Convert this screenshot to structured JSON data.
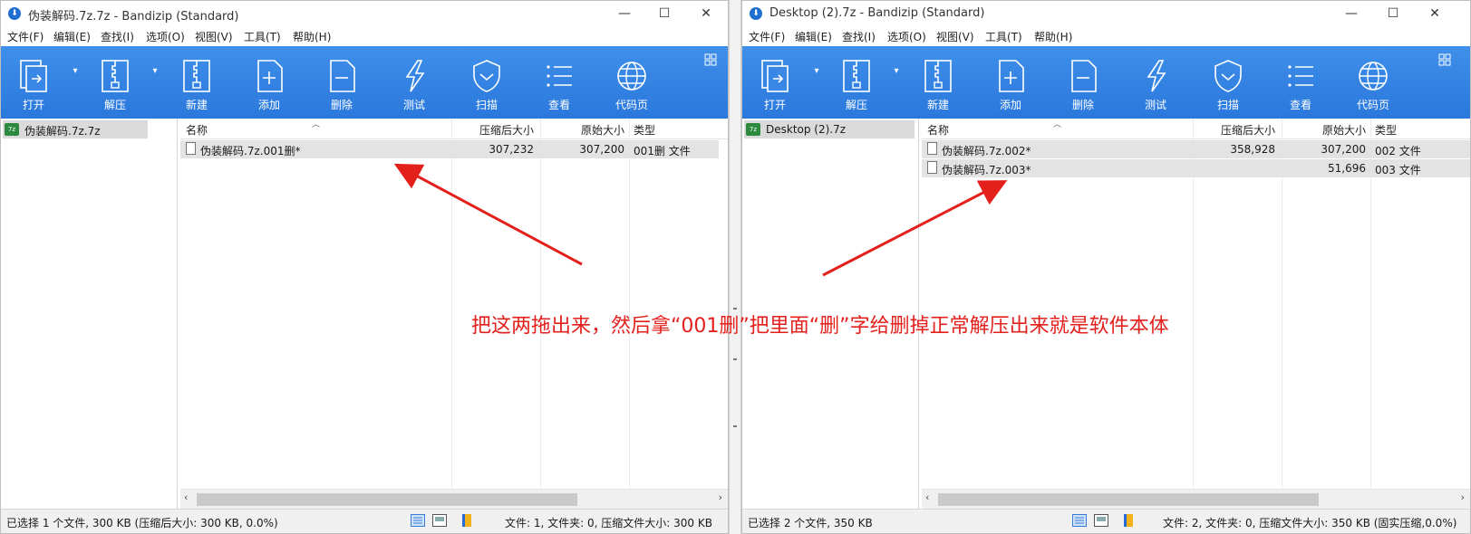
{
  "left": {
    "title": "伪装解码.7z.7z - Bandizip (Standard)",
    "menu": [
      "文件(F)",
      "编辑(E)",
      "查找(I)",
      "选项(O)",
      "视图(V)",
      "工具(T)",
      "帮助(H)"
    ],
    "toolbar": [
      "打开",
      "解压",
      "新建",
      "添加",
      "删除",
      "测试",
      "扫描",
      "查看",
      "代码页"
    ],
    "tree_item": "伪装解码.7z.7z",
    "columns": [
      "名称",
      "压缩后大小",
      "原始大小",
      "类型"
    ],
    "rows": [
      {
        "name": "伪装解码.7z.001删*",
        "packed": "307,232",
        "size": "307,200",
        "type": "001删 文件"
      }
    ],
    "status_left": "已选择 1 个文件, 300 KB (压缩后大小: 300 KB, 0.0%)",
    "status_right": "文件: 1, 文件夹: 0, 压缩文件大小: 300 KB"
  },
  "right": {
    "title": "Desktop (2).7z - Bandizip (Standard)",
    "menu": [
      "文件(F)",
      "编辑(E)",
      "查找(I)",
      "选项(O)",
      "视图(V)",
      "工具(T)",
      "帮助(H)"
    ],
    "toolbar": [
      "打开",
      "解压",
      "新建",
      "添加",
      "删除",
      "测试",
      "扫描",
      "查看",
      "代码页"
    ],
    "tree_item": "Desktop (2).7z",
    "columns": [
      "名称",
      "压缩后大小",
      "原始大小",
      "类型"
    ],
    "rows": [
      {
        "name": "伪装解码.7z.002*",
        "packed": "358,928",
        "size": "307,200",
        "type": "002 文件"
      },
      {
        "name": "伪装解码.7z.003*",
        "packed": "",
        "size": "51,696",
        "type": "003 文件"
      }
    ],
    "status_left": "已选择 2 个文件, 350 KB",
    "status_right": "文件: 2, 文件夹: 0, 压缩文件大小: 350 KB (固实压缩,0.0%)"
  },
  "annotation": "把这两拖出来，然后拿“001删”把里面“删”字给删掉正常解压出来就是软件本体",
  "colors": {
    "toolbar": "#2f7fe0",
    "annotation": "#e4201c"
  },
  "icons": [
    "open-icon",
    "extract-icon",
    "new-icon",
    "add-icon",
    "delete-icon",
    "test-icon",
    "scan-icon",
    "view-icon",
    "codepage-icon"
  ]
}
